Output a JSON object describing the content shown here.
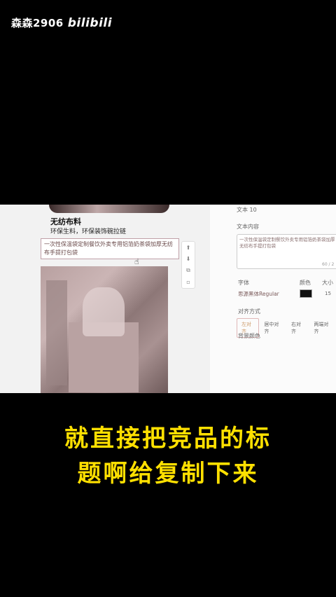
{
  "watermark": {
    "user": "森森2906",
    "brand": "bilibili"
  },
  "product": {
    "title": "无纺布料",
    "subtitle": "环保生料，环保装饰碗拉链",
    "edit_text": "一次性保温袋定制餐饮外卖专用铝箔奶茶袋加厚无纺布手提打包袋"
  },
  "panel": {
    "section_label": "文本 10",
    "content_label": "文本内容",
    "content_value": "一次性保温袋定制餐饮外卖专用铝箔奶茶袋加厚无纺布手提打包袋",
    "count": "60 / 2",
    "font_label": "字体",
    "color_label": "颜色",
    "size_label": "大小",
    "font_value": "思源黑体Regular",
    "size_value": "15",
    "align_label": "对齐方式",
    "align_options": [
      "左对齐",
      "居中对齐",
      "右对齐",
      "两端对齐"
    ],
    "bg_label": "背景颜色",
    "text_color": "#111111"
  },
  "subtitle": {
    "line1": "就直接把竞品的标",
    "line2": "题啊给复制下来"
  }
}
